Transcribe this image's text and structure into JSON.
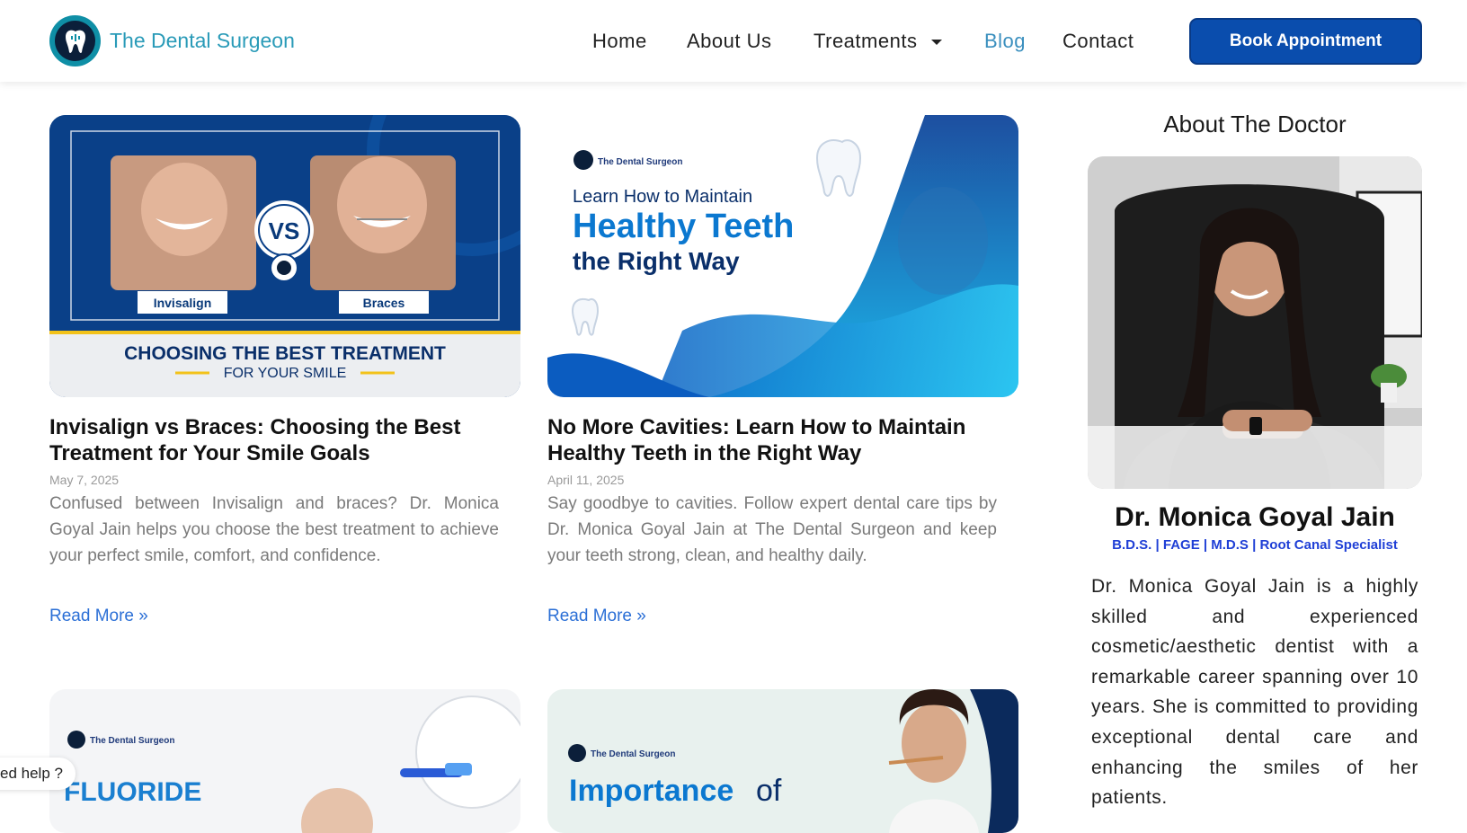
{
  "brand": {
    "name": "The Dental Surgeon"
  },
  "nav": {
    "items": [
      {
        "label": "Home"
      },
      {
        "label": "About Us"
      },
      {
        "label": "Treatments"
      },
      {
        "label": "Blog"
      },
      {
        "label": "Contact"
      }
    ],
    "cta_label": "Book Appointment"
  },
  "posts": [
    {
      "title": "Invisalign vs Braces: Choosing the Best Treatment for Your Smile Goals",
      "date": "May 7, 2025",
      "excerpt": "Confused between Invisalign and braces? Dr. Monica Goyal Jain helps you choose the best treatment to achieve your perfect smile, comfort, and confidence.",
      "read_more": "Read More »",
      "image": {
        "left_label": "Invisalign",
        "vs_label": "VS",
        "right_label": "Braces",
        "headline": "CHOOSING THE BEST TREATMENT",
        "subheadline": "FOR YOUR SMILE"
      }
    },
    {
      "title": "No More Cavities: Learn How to Maintain Healthy Teeth in the Right Way",
      "date": "April 11, 2025",
      "excerpt": "Say goodbye to cavities. Follow expert dental care tips by Dr. Monica Goyal Jain at The Dental Surgeon and keep your teeth strong, clean, and healthy daily.",
      "read_more": "Read More »",
      "image": {
        "brand": "The Dental Surgeon",
        "line1": "Learn How to Maintain",
        "line2": "Healthy Teeth",
        "line3": "the Right Way"
      }
    },
    {
      "image": {
        "brand": "The Dental Surgeon",
        "headline": "FLUORIDE"
      }
    },
    {
      "image": {
        "brand": "The Dental Surgeon",
        "headline_a": "Importance",
        "headline_b": "of"
      }
    }
  ],
  "sidebar": {
    "title": "About The Doctor",
    "doctor_name": "Dr. Monica Goyal Jain",
    "credentials": "B.D.S. | FAGE | M.D.S | Root Canal Specialist",
    "bio": "Dr. Monica Goyal Jain is a highly skilled and experienced cosmetic/aesthetic dentist with a remarkable career spanning over 10 years. She is committed to providing exceptional dental care and enhancing the smiles of her patients."
  },
  "help_tab": {
    "label": "ed help ?"
  },
  "colors": {
    "primary": "#0a4dad",
    "brand_teal": "#2a9bb8",
    "link": "#2b6fd6",
    "nav_active": "#3a8fbe",
    "credentials": "#1f3fd6"
  },
  "icons": {
    "logo": "tooth-icon",
    "treatments_dropdown": "caret-down-icon"
  }
}
